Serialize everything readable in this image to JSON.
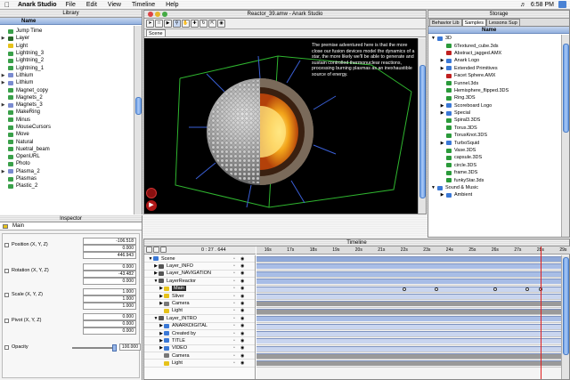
{
  "menubar": {
    "apple": "",
    "app": "Anark Studio",
    "menus": [
      "File",
      "Edit",
      "View",
      "Timeline",
      "Help"
    ],
    "time": "6:58 PM"
  },
  "library": {
    "title": "Library",
    "column": "Name",
    "items": [
      {
        "label": "Jump Time",
        "arrow": "",
        "color": "#3aa04a"
      },
      {
        "label": "Layer",
        "arrow": "▶",
        "color": "#2a6a2a"
      },
      {
        "label": "Light",
        "arrow": "",
        "color": "#e6c21a"
      },
      {
        "label": "Lightning_3",
        "arrow": "",
        "color": "#3aa04a"
      },
      {
        "label": "Lightning_2",
        "arrow": "",
        "color": "#3aa04a"
      },
      {
        "label": "Lightning_1",
        "arrow": "",
        "color": "#3aa04a"
      },
      {
        "label": "Lithium",
        "arrow": "▶",
        "color": "#7a8bd0"
      },
      {
        "label": "Lithium",
        "arrow": "▶",
        "color": "#7a8bd0"
      },
      {
        "label": "Magnet_copy",
        "arrow": "",
        "color": "#3aa04a"
      },
      {
        "label": "Magnets_2",
        "arrow": "",
        "color": "#3aa04a"
      },
      {
        "label": "Magnets_3",
        "arrow": "▶",
        "color": "#7a8bd0"
      },
      {
        "label": "MakeRing",
        "arrow": "",
        "color": "#3aa04a"
      },
      {
        "label": "Minus",
        "arrow": "",
        "color": "#3aa04a"
      },
      {
        "label": "MouseCursors",
        "arrow": "",
        "color": "#3aa04a"
      },
      {
        "label": "Move",
        "arrow": "",
        "color": "#3aa04a"
      },
      {
        "label": "Natural",
        "arrow": "",
        "color": "#3aa04a"
      },
      {
        "label": "Nuetral_beam",
        "arrow": "",
        "color": "#3aa04a"
      },
      {
        "label": "OpenURL",
        "arrow": "",
        "color": "#3aa04a"
      },
      {
        "label": "Photo",
        "arrow": "",
        "color": "#3aa04a"
      },
      {
        "label": "Plasma_2",
        "arrow": "▶",
        "color": "#7a8bd0"
      },
      {
        "label": "Plasmas",
        "arrow": "",
        "color": "#3aa04a"
      },
      {
        "label": "Plastic_2",
        "arrow": "",
        "color": "#3aa04a"
      }
    ]
  },
  "document": {
    "title": "Reactor_39.amw - Anark Studio",
    "scene_tab": "Scene",
    "caption": "The premise adventured here is that the more close our fusion devices model the dynamics of a star, the more likely we'll be able to generate and sustain controlled thermonuclear reactions, processing burning plasmas as an inexhaustible source of energy."
  },
  "storage": {
    "title": "Storage",
    "tabs": [
      "Behavior Lib",
      "Samples",
      "Lessons Sup"
    ],
    "active_tab": 1,
    "column": "Name",
    "items": [
      {
        "label": "3D",
        "arrow": "▼",
        "color": "#3a78d6",
        "indent": 0
      },
      {
        "label": "6Textured_cube.3ds",
        "arrow": "",
        "color": "#2a9a3a",
        "indent": 1
      },
      {
        "label": "Abstract_jagged.AMX",
        "arrow": "",
        "color": "#c02020",
        "indent": 1
      },
      {
        "label": "Anark Logo",
        "arrow": "▶",
        "color": "#3a78d6",
        "indent": 1
      },
      {
        "label": "Extended Primitives",
        "arrow": "▶",
        "color": "#3a78d6",
        "indent": 1
      },
      {
        "label": "Facet Sphere.AMX",
        "arrow": "",
        "color": "#c02020",
        "indent": 1
      },
      {
        "label": "Funnel.3ds",
        "arrow": "",
        "color": "#2a9a3a",
        "indent": 1
      },
      {
        "label": "Hemisphere_flipped.3DS",
        "arrow": "",
        "color": "#2a9a3a",
        "indent": 1
      },
      {
        "label": "Ring.3DS",
        "arrow": "",
        "color": "#2a9a3a",
        "indent": 1
      },
      {
        "label": "Scoreboard Logo",
        "arrow": "▶",
        "color": "#3a78d6",
        "indent": 1
      },
      {
        "label": "Special",
        "arrow": "▶",
        "color": "#3a78d6",
        "indent": 1
      },
      {
        "label": "Spiral3.3DS",
        "arrow": "",
        "color": "#2a9a3a",
        "indent": 1
      },
      {
        "label": "Torus.3DS",
        "arrow": "",
        "color": "#2a9a3a",
        "indent": 1
      },
      {
        "label": "TorusKnot.3DS",
        "arrow": "",
        "color": "#2a9a3a",
        "indent": 1
      },
      {
        "label": "TurboSquid",
        "arrow": "▶",
        "color": "#3a78d6",
        "indent": 1
      },
      {
        "label": "Vase.3DS",
        "arrow": "",
        "color": "#2a9a3a",
        "indent": 1
      },
      {
        "label": "capsule.3DS",
        "arrow": "",
        "color": "#2a9a3a",
        "indent": 1
      },
      {
        "label": "circle.3DS",
        "arrow": "",
        "color": "#2a9a3a",
        "indent": 1
      },
      {
        "label": "frame.3DS",
        "arrow": "",
        "color": "#2a9a3a",
        "indent": 1
      },
      {
        "label": "funkyStar.3ds",
        "arrow": "",
        "color": "#2a9a3a",
        "indent": 1
      },
      {
        "label": "Sound & Music",
        "arrow": "▼",
        "color": "#3a78d6",
        "indent": 0
      },
      {
        "label": "Ambient",
        "arrow": "▶",
        "color": "#3a78d6",
        "indent": 1
      }
    ]
  },
  "inspector": {
    "title": "Inspector",
    "object": "Main",
    "position": {
      "label": "Position (X, Y, Z)",
      "values": [
        "-106.518",
        "0.000",
        "446.943"
      ]
    },
    "rotation": {
      "label": "Rotation (X, Y, Z)",
      "values": [
        "0.000",
        "-43.482",
        "0.000"
      ]
    },
    "scale": {
      "label": "Scale (X, Y, Z)",
      "values": [
        "1.000",
        "1.000",
        "1.000"
      ]
    },
    "pivot": {
      "label": "Pivot (X, Y, Z)",
      "values": [
        "0.000",
        "0.000",
        "0.000"
      ]
    },
    "opacity": {
      "label": "Opacity",
      "value": "100.000",
      "level": 1.0
    }
  },
  "timeline": {
    "title": "Timeline",
    "time": "0 : 27 . 644",
    "ruler": [
      "16s",
      "17s",
      "18s",
      "19s",
      "20s",
      "21s",
      "22s",
      "23s",
      "24s",
      "25s",
      "26s",
      "27s",
      "28s",
      "29s"
    ],
    "playhead_time": 28.0,
    "layers": [
      {
        "label": "Scene",
        "indent": 0,
        "arrow": "▼",
        "color": "#3a78d6",
        "selected": false
      },
      {
        "label": "Layer_INFO",
        "indent": 1,
        "arrow": "▶",
        "color": "#555",
        "selected": false
      },
      {
        "label": "Layer_NAVIGATION",
        "indent": 1,
        "arrow": "▶",
        "color": "#555",
        "selected": false
      },
      {
        "label": "LayerReactor",
        "indent": 1,
        "arrow": "▼",
        "color": "#555",
        "selected": false
      },
      {
        "label": "Main",
        "indent": 2,
        "arrow": "▶",
        "color": "#e6c21a",
        "selected": true
      },
      {
        "label": "Sliver",
        "indent": 2,
        "arrow": "▶",
        "color": "#e6c21a",
        "selected": false
      },
      {
        "label": "Camera",
        "indent": 2,
        "arrow": "▶",
        "color": "#777",
        "selected": false
      },
      {
        "label": "Light",
        "indent": 2,
        "arrow": "",
        "color": "#e6c21a",
        "selected": false
      },
      {
        "label": "Layer_INTRO",
        "indent": 1,
        "arrow": "▼",
        "color": "#555",
        "selected": false
      },
      {
        "label": "ANARKDIGITAL",
        "indent": 2,
        "arrow": "▶",
        "color": "#3a78d6",
        "selected": false
      },
      {
        "label": "Created by",
        "indent": 2,
        "arrow": "▶",
        "color": "#3a78d6",
        "selected": false
      },
      {
        "label": "TITLE",
        "indent": 2,
        "arrow": "▶",
        "color": "#3a78d6",
        "selected": false
      },
      {
        "label": "VIDEO",
        "indent": 2,
        "arrow": "▶",
        "color": "#3a78d6",
        "selected": false
      },
      {
        "label": "Camera",
        "indent": 2,
        "arrow": "",
        "color": "#777",
        "selected": false
      },
      {
        "label": "Light",
        "indent": 2,
        "arrow": "",
        "color": "#e6c21a",
        "selected": false
      }
    ],
    "keyframes": [
      22.0,
      23.4,
      26.0,
      27.4,
      28.0,
      29.0
    ]
  }
}
